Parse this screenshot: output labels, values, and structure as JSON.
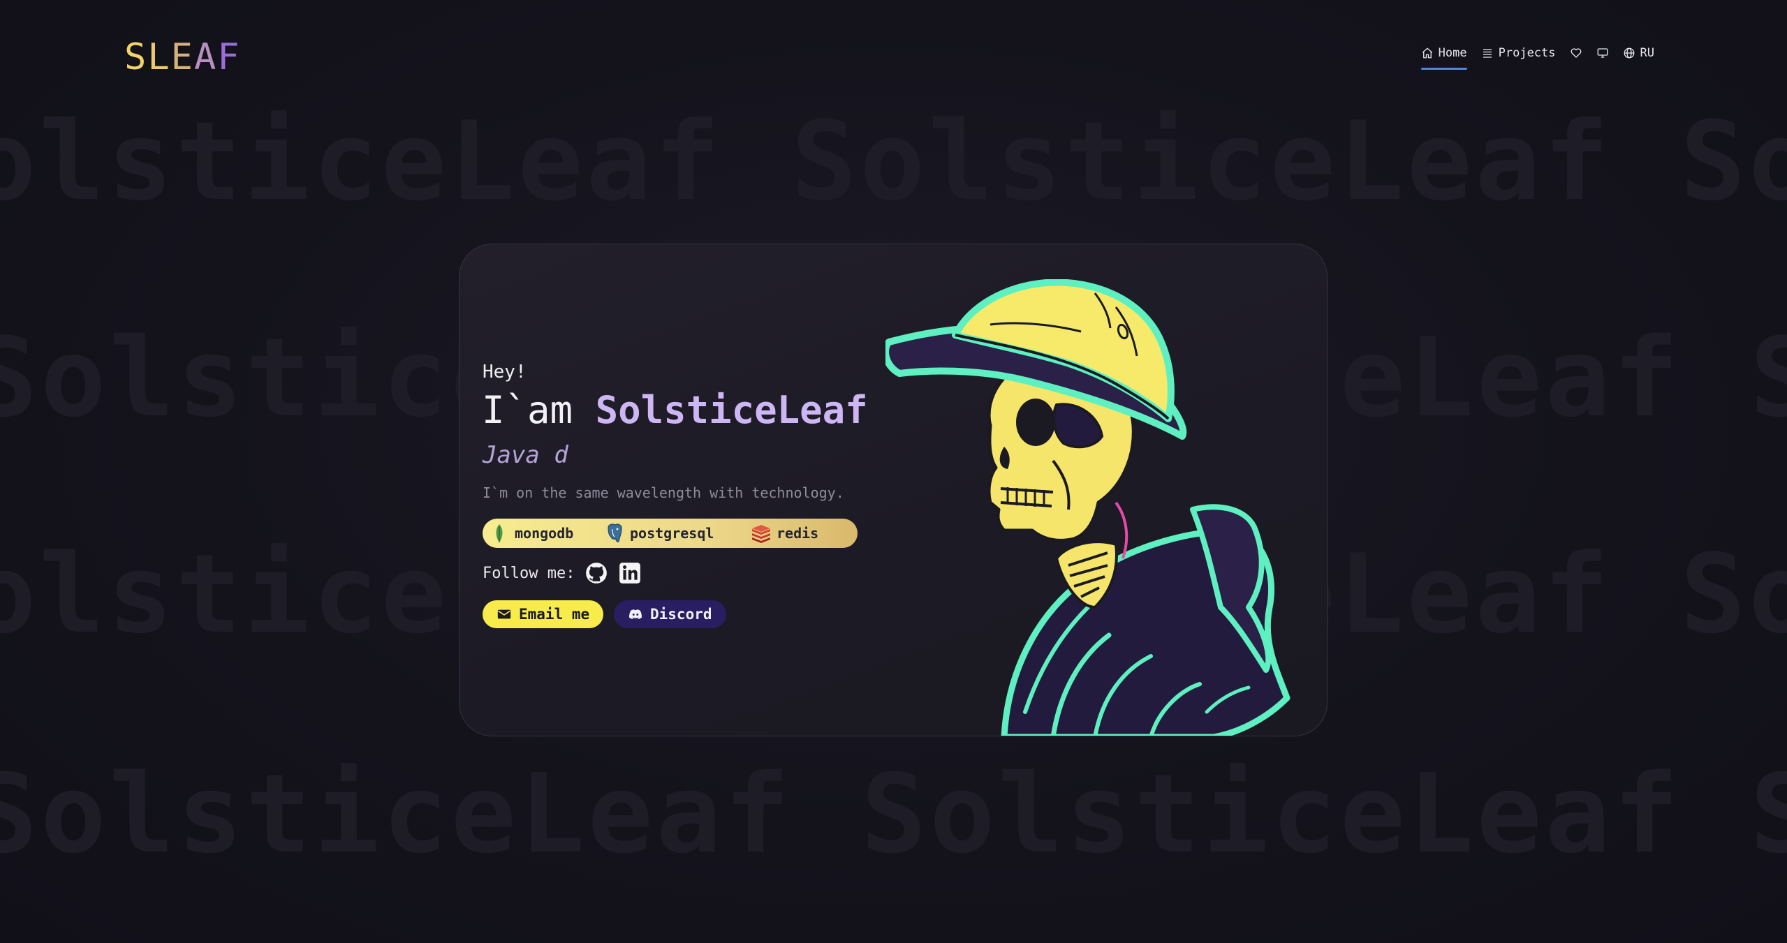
{
  "background": {
    "watermark_text": "SolsticeLeaf SolsticeLeaf SolsticeLeaf SolsticeLeaf"
  },
  "header": {
    "logo_letters": [
      "S",
      "L",
      "E",
      "A",
      "F"
    ],
    "nav": {
      "home_label": "Home",
      "projects_label": "Projects",
      "language_label": "RU"
    }
  },
  "hero": {
    "greeting": "Hey!",
    "intro_prefix": "I`am ",
    "name": "SolsticeLeaf",
    "role": "Java d",
    "tagline": "I`m on the same wavelength with technology.",
    "tech_stack": [
      "mongodb",
      "postgresql",
      "redis"
    ],
    "follow_label": "Follow me:",
    "email_button": "Email me",
    "discord_button": "Discord"
  },
  "colors": {
    "accent_yellow": "#f8ec4c",
    "accent_purple": "#cdb6f4",
    "discord_bg": "#2a1e62",
    "nav_underline": "#4f86d8",
    "art_outline": "#5ef0c0"
  }
}
